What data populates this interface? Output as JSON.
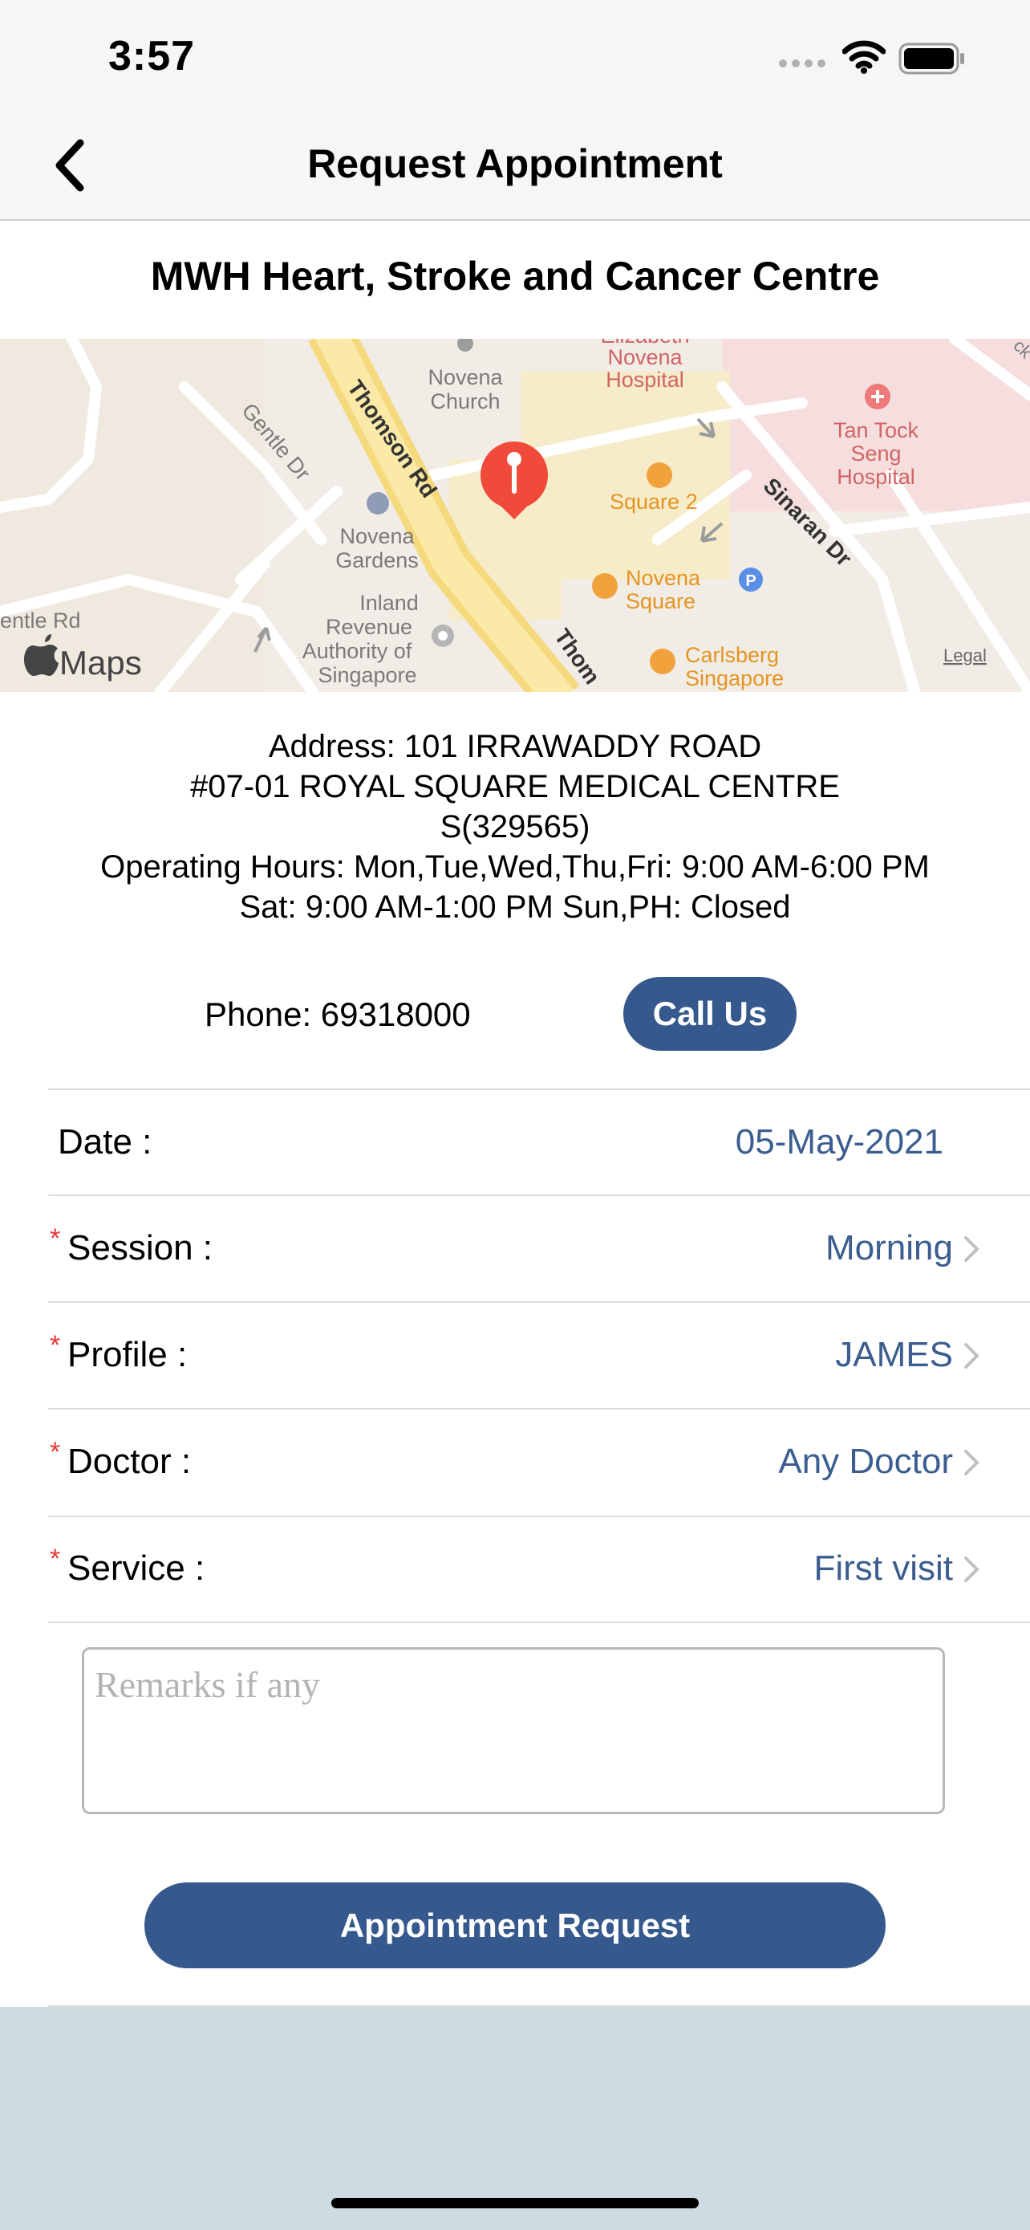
{
  "status_bar": {
    "time": "3:57"
  },
  "nav": {
    "title": "Request Appointment"
  },
  "clinic": {
    "name": "MWH Heart, Stroke and Cancer Centre"
  },
  "map": {
    "labels": {
      "elizabeth": "Elizabeth",
      "novena_hospital_1": "Novena",
      "novena_hospital_2": "Hospital",
      "novena_church_1": "Novena",
      "novena_church_2": "Church",
      "gentle_dr": "Gentle Dr",
      "thomson_rd": "Thomson Rd",
      "thomson_rd_2": "Thom",
      "novena_gardens_1": "Novena",
      "novena_gardens_2": "Gardens",
      "iras_1": "Inland",
      "iras_2": "Revenue",
      "iras_3": "Authority of",
      "iras_4": "Singapore",
      "square2": "Square 2",
      "novena_square_1": "Novena",
      "novena_square_2": "Square",
      "carlsberg_1": "Carlsberg",
      "carlsberg_2": "Singapore",
      "ttsh_1": "Tan Tock",
      "ttsh_2": "Seng",
      "ttsh_3": "Hospital",
      "sinaran_dr": "Sinaran Dr",
      "gentle_rd": "entle Rd",
      "corner": "ck",
      "maps_logo": "Maps",
      "legal": "Legal",
      "parking": "P"
    }
  },
  "details": {
    "address_line1": "Address: 101 IRRAWADDY ROAD",
    "address_line2": "#07-01 ROYAL SQUARE MEDICAL CENTRE",
    "address_line3": "S(329565)",
    "hours_line1": "Operating Hours: Mon,Tue,Wed,Thu,Fri: 9:00 AM-6:00 PM",
    "hours_line2": "Sat: 9:00 AM-1:00 PM Sun,PH: Closed",
    "phone": "Phone: 69318000",
    "call_button": "Call Us"
  },
  "form": {
    "required_marker": "*",
    "date": {
      "label": "Date :",
      "value": "05-May-2021"
    },
    "session": {
      "label": "Session :",
      "value": "Morning"
    },
    "profile": {
      "label": "Profile :",
      "value": "JAMES"
    },
    "doctor": {
      "label": "Doctor :",
      "value": "Any Doctor"
    },
    "service": {
      "label": "Service :",
      "value": "First visit"
    },
    "remarks": {
      "placeholder": "Remarks if any",
      "value": ""
    },
    "submit": "Appointment Request"
  },
  "colors": {
    "accent": "#36598d",
    "link": "#3b5d8f",
    "required": "#e53935",
    "footer": "#cddce2"
  }
}
